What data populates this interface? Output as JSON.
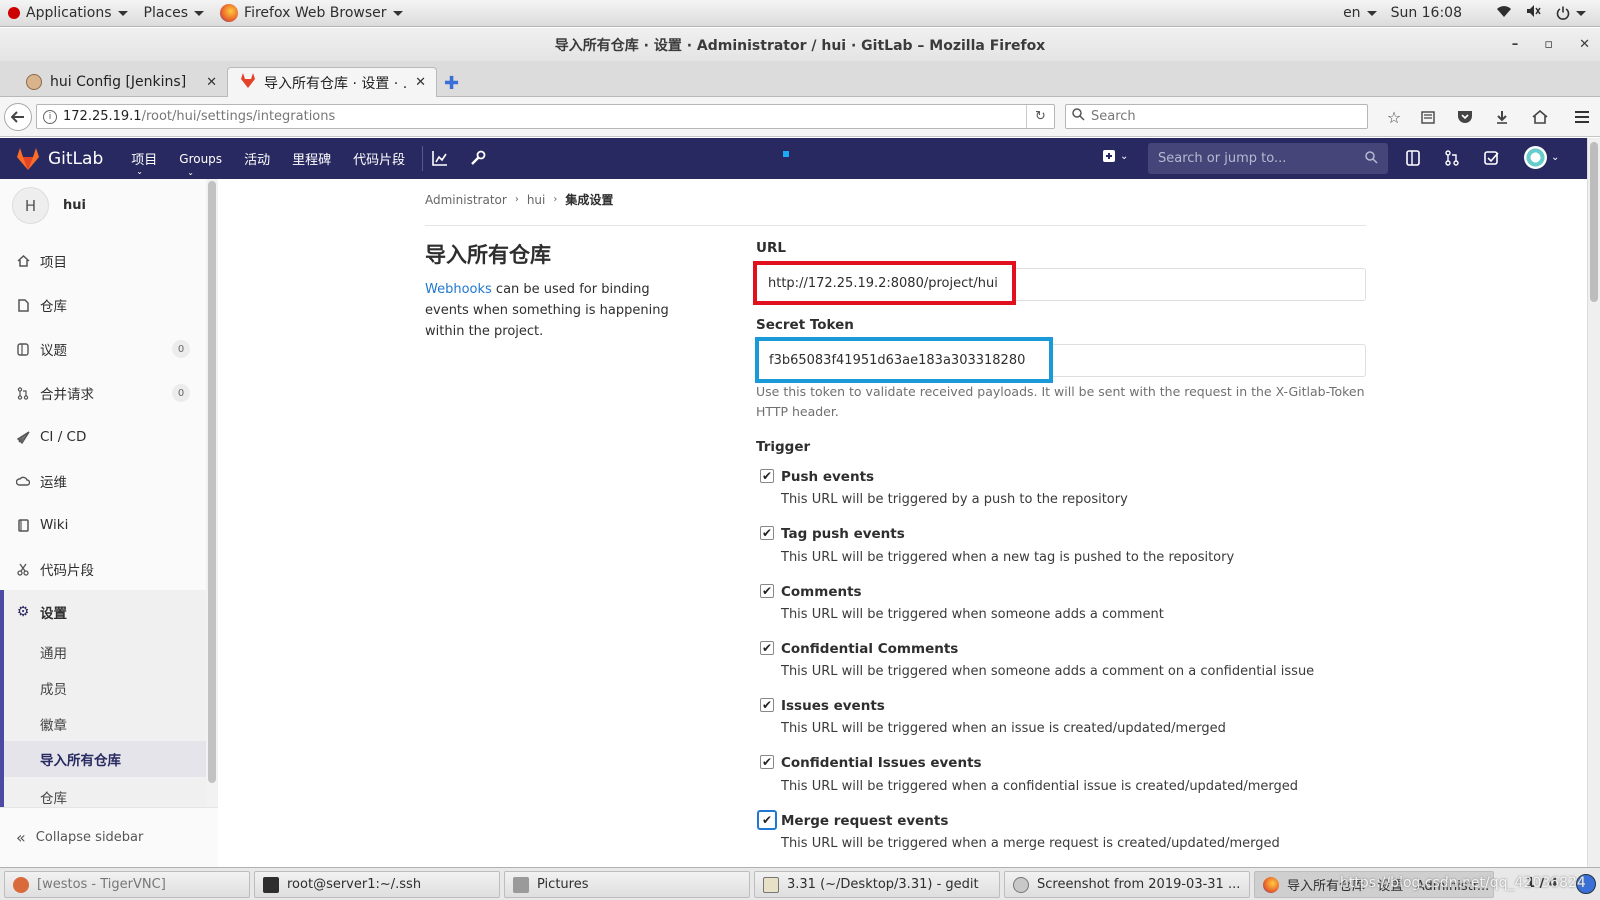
{
  "topbar": {
    "applications": "Applications",
    "places": "Places",
    "firefox": "Firefox Web Browser",
    "lang": "en",
    "clock": "Sun 16:08"
  },
  "window": {
    "title": "导入所有仓库 · 设置 · Administrator / hui · GitLab – Mozilla Firefox"
  },
  "tabs": [
    {
      "label": "hui Config [Jenkins]"
    },
    {
      "label": "导入所有仓库 · 设置 · ..."
    }
  ],
  "navbar": {
    "url_host": "172.25.19.1",
    "url_path": "/root/hui/settings/integrations",
    "search_placeholder": "Search"
  },
  "gitlab_header": {
    "brand": "GitLab",
    "menu": [
      "项目",
      "Groups",
      "活动",
      "里程碑",
      "代码片段"
    ],
    "search_placeholder": "Search or jump to..."
  },
  "sidebar": {
    "project_avatar": "H",
    "project_name": "hui",
    "items": [
      {
        "label": "项目",
        "icon": "home-icon"
      },
      {
        "label": "仓库",
        "icon": "doc-icon"
      },
      {
        "label": "议题",
        "icon": "issues-icon",
        "badge": "0"
      },
      {
        "label": "合并请求",
        "icon": "merge-request-icon",
        "badge": "0"
      },
      {
        "label": "CI / CD",
        "icon": "rocket-icon"
      },
      {
        "label": "运维",
        "icon": "cloud-icon"
      },
      {
        "label": "Wiki",
        "icon": "book-icon"
      },
      {
        "label": "代码片段",
        "icon": "scissors-icon"
      },
      {
        "label": "设置",
        "icon": "gear-icon"
      }
    ],
    "sub_items": [
      "通用",
      "成员",
      "徽章",
      "导入所有仓库",
      "仓库"
    ],
    "collapse": "Collapse sidebar"
  },
  "breadcrumb": [
    "Administrator",
    "hui",
    "集成设置"
  ],
  "page": {
    "title": "导入所有仓库",
    "desc_link": "Webhooks",
    "desc_text": " can be used for binding events when something is happening within the project."
  },
  "form": {
    "url_label": "URL",
    "url_value": "http://172.25.19.2:8080/project/hui",
    "token_label": "Secret Token",
    "token_value": "f3b65083f41951d63ae183a303318280",
    "token_help": "Use this token to validate received payloads. It will be sent with the request in the X-Gitlab-Token HTTP header.",
    "trigger_label": "Trigger",
    "triggers": [
      {
        "label": "Push events",
        "help": "This URL will be triggered by a push to the repository",
        "checked": true
      },
      {
        "label": "Tag push events",
        "help": "This URL will be triggered when a new tag is pushed to the repository",
        "checked": true
      },
      {
        "label": "Comments",
        "help": "This URL will be triggered when someone adds a comment",
        "checked": true
      },
      {
        "label": "Confidential Comments",
        "help": "This URL will be triggered when someone adds a comment on a confidential issue",
        "checked": true
      },
      {
        "label": "Issues events",
        "help": "This URL will be triggered when an issue is created/updated/merged",
        "checked": true
      },
      {
        "label": "Confidential Issues events",
        "help": "This URL will be triggered when a confidential issue is created/updated/merged",
        "checked": true
      },
      {
        "label": "Merge request events",
        "help": "This URL will be triggered when a merge request is created/updated/merged",
        "checked": true
      }
    ]
  },
  "taskbar": [
    {
      "label": "[westos - TigerVNC]"
    },
    {
      "label": "root@server1:~/.ssh"
    },
    {
      "label": "Pictures"
    },
    {
      "label": "3.31 (~/Desktop/3.31) - gedit"
    },
    {
      "label": "Screenshot from 2019-03-31 ..."
    },
    {
      "label": "导入所有仓库 · 设置 · Administr..."
    }
  ],
  "workspace": "1 / 4",
  "watermark": "https://blog.csdn.net/qq_42036824",
  "colors": {
    "gitlab_header": "#292961",
    "highlight_red": "#e0101f",
    "highlight_blue": "#1a9ad6",
    "link": "#1f78d1"
  }
}
